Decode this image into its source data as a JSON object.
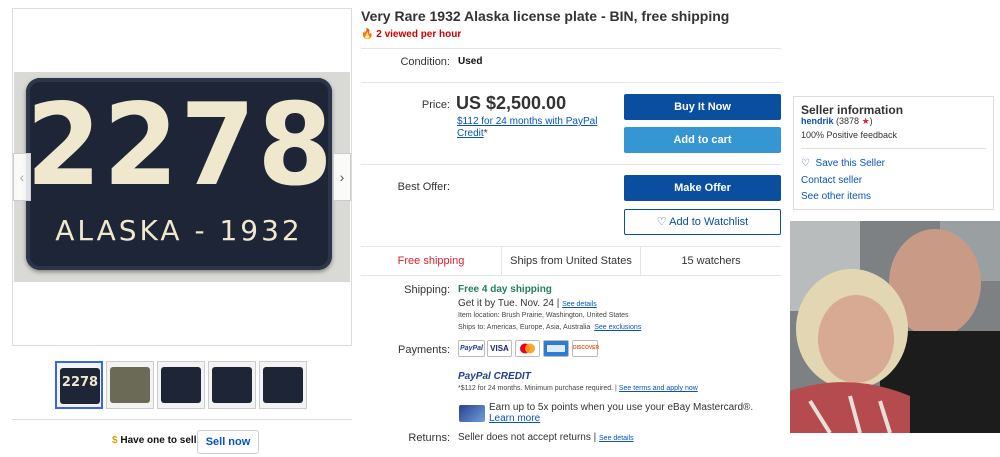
{
  "listing": {
    "title": "Very Rare 1932 Alaska license plate - BIN, free shipping",
    "views": "2 viewed per hour"
  },
  "gallery": {
    "plate_number": "2278",
    "plate_line": "ALASKA - 1932",
    "prev_arrow": "‹",
    "next_arrow": "›",
    "thumbs": [
      "2278",
      "",
      "",
      "",
      ""
    ],
    "have_one": "Have one to sell?",
    "sell_now": "Sell now"
  },
  "details": {
    "condition_label": "Condition:",
    "condition_value": "Used",
    "price_label": "Price:",
    "price_value": "US $2,500.00",
    "credit_link": "$112 for 24 months with PayPal Credit",
    "credit_mark": "*",
    "buy_now": "Buy It Now",
    "add_cart": "Add to cart",
    "offer_label": "Best Offer:",
    "make_offer": "Make Offer",
    "watchlist": "Add to Watchlist"
  },
  "strip": {
    "free_shipping": "Free shipping",
    "ships_from": "Ships from United States",
    "watchers": "15 watchers"
  },
  "shipping": {
    "label": "Shipping:",
    "value": "Free 4 day shipping",
    "delivery": "Get it by Tue. Nov. 24 |",
    "see_details": "See details",
    "item_location": "Item location:  Brush Prairie, Washington, United States",
    "ships_to": "Ships to:  Americas, Europe, Asia, Australia",
    "see_exclusions": "See exclusions"
  },
  "payments": {
    "label": "Payments:",
    "cards": [
      "PayPal",
      "VISA",
      "",
      "",
      "DISCOVER"
    ],
    "paypal_credit": "PayPal CREDIT",
    "credit_terms": "*$112 for 24 months. Minimum purchase required.  |",
    "terms_link": "See terms and apply now",
    "mastercard_text": "Earn up to 5x points when you use your eBay Mastercard®.",
    "learn_more": "Learn more"
  },
  "returns": {
    "label": "Returns:",
    "value": "Seller does not accept returns |",
    "see_details": "See details"
  },
  "seller": {
    "title": "Seller information",
    "name": "hendrik",
    "score": "(3878",
    "score_end": ")",
    "feedback": "100% Positive feedback",
    "save": "Save this Seller",
    "contact": "Contact seller",
    "other": "See other items"
  },
  "colors": {
    "primary_button": "#0a4ea0",
    "secondary_button": "#3596d3",
    "link": "#0654ba",
    "free_shipping": "#dd1e31",
    "shipping_green": "#21805a"
  }
}
